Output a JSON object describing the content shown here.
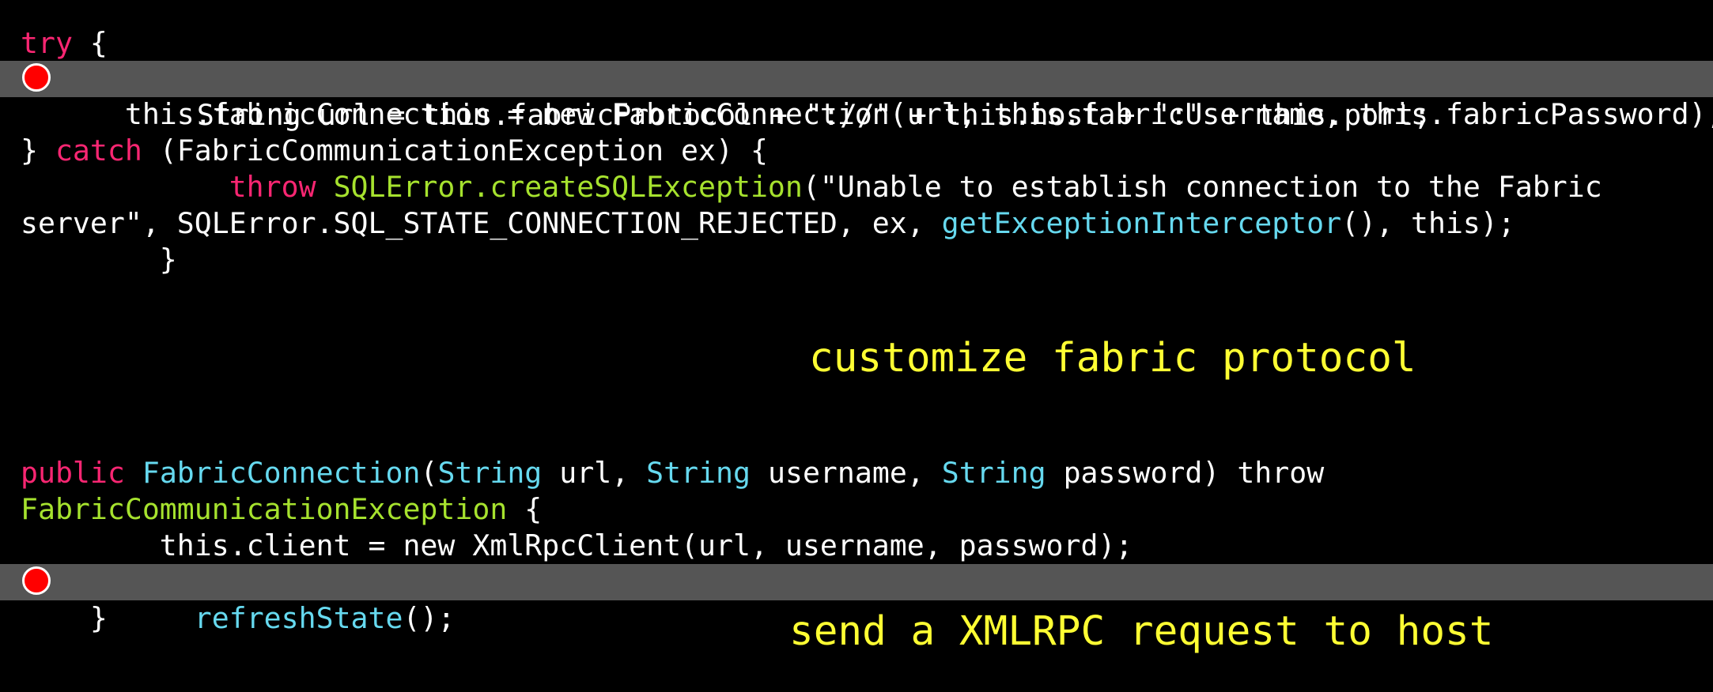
{
  "colors": {
    "background": "#000000",
    "highlight_bar": "#555555",
    "keyword": "#f92672",
    "function": "#66d9ef",
    "class_name": "#a6e22e",
    "annotation": "#ffff33",
    "breakpoint": "#ff0000"
  },
  "snippet1": {
    "line1": {
      "kw": "try",
      "rest": " {"
    },
    "line2": {
      "text": "   String url = this.fabricProtocol + \"://\" + this.host + \":\" + this.port;"
    },
    "line3": {
      "text": "      this.fabricConnection = new FabricConnection(url, this.fabricUsername, this.fabricPassword);"
    },
    "line4": {
      "brace": "} ",
      "kw": "catch",
      "rest": " (FabricCommunicationException ex) {"
    },
    "line5": {
      "indent": "            ",
      "kw": "throw",
      "sp": " ",
      "cls": "SQLError.createSQLException",
      "rest": "(\"Unable to establish connection to the Fabric"
    },
    "line6": {
      "pre": "server\", SQLError.SQL_STATE_CONNECTION_REJECTED, ex, ",
      "fn": "getExceptionInterceptor",
      "rest": "(), this);"
    },
    "line7": {
      "text": "        }"
    }
  },
  "snippet2": {
    "line1": {
      "kw": "public",
      "sp1": " ",
      "fn1": "FabricConnection",
      "p1": "(",
      "fn2": "String",
      "p2": " url, ",
      "fn3": "String",
      "p3": " username, ",
      "fn4": "String",
      "p4": " password) throw"
    },
    "line2": {
      "cls": "FabricCommunicationException",
      "rest": " {"
    },
    "line3": {
      "text": "        this.client = new XmlRpcClient(url, username, password);"
    },
    "line4": {
      "indent": "        ",
      "fn": "refreshState",
      "rest": "();"
    },
    "line5": {
      "text": "    }"
    }
  },
  "annotations": {
    "first": "customize fabric protocol",
    "second": "send a XMLRPC request to host"
  }
}
